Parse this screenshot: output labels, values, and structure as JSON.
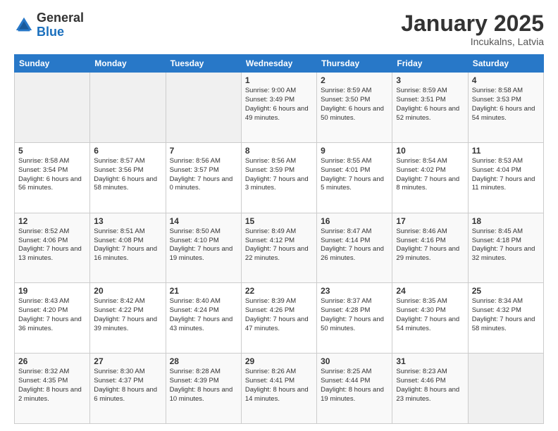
{
  "header": {
    "logo_general": "General",
    "logo_blue": "Blue",
    "title": "January 2025",
    "subtitle": "Incukalns, Latvia"
  },
  "weekdays": [
    "Sunday",
    "Monday",
    "Tuesday",
    "Wednesday",
    "Thursday",
    "Friday",
    "Saturday"
  ],
  "weeks": [
    [
      {
        "day": "",
        "sunrise": "",
        "sunset": "",
        "daylight": "",
        "empty": true
      },
      {
        "day": "",
        "sunrise": "",
        "sunset": "",
        "daylight": "",
        "empty": true
      },
      {
        "day": "",
        "sunrise": "",
        "sunset": "",
        "daylight": "",
        "empty": true
      },
      {
        "day": "1",
        "sunrise": "Sunrise: 9:00 AM",
        "sunset": "Sunset: 3:49 PM",
        "daylight": "Daylight: 6 hours and 49 minutes."
      },
      {
        "day": "2",
        "sunrise": "Sunrise: 8:59 AM",
        "sunset": "Sunset: 3:50 PM",
        "daylight": "Daylight: 6 hours and 50 minutes."
      },
      {
        "day": "3",
        "sunrise": "Sunrise: 8:59 AM",
        "sunset": "Sunset: 3:51 PM",
        "daylight": "Daylight: 6 hours and 52 minutes."
      },
      {
        "day": "4",
        "sunrise": "Sunrise: 8:58 AM",
        "sunset": "Sunset: 3:53 PM",
        "daylight": "Daylight: 6 hours and 54 minutes."
      }
    ],
    [
      {
        "day": "5",
        "sunrise": "Sunrise: 8:58 AM",
        "sunset": "Sunset: 3:54 PM",
        "daylight": "Daylight: 6 hours and 56 minutes."
      },
      {
        "day": "6",
        "sunrise": "Sunrise: 8:57 AM",
        "sunset": "Sunset: 3:56 PM",
        "daylight": "Daylight: 6 hours and 58 minutes."
      },
      {
        "day": "7",
        "sunrise": "Sunrise: 8:56 AM",
        "sunset": "Sunset: 3:57 PM",
        "daylight": "Daylight: 7 hours and 0 minutes."
      },
      {
        "day": "8",
        "sunrise": "Sunrise: 8:56 AM",
        "sunset": "Sunset: 3:59 PM",
        "daylight": "Daylight: 7 hours and 3 minutes."
      },
      {
        "day": "9",
        "sunrise": "Sunrise: 8:55 AM",
        "sunset": "Sunset: 4:01 PM",
        "daylight": "Daylight: 7 hours and 5 minutes."
      },
      {
        "day": "10",
        "sunrise": "Sunrise: 8:54 AM",
        "sunset": "Sunset: 4:02 PM",
        "daylight": "Daylight: 7 hours and 8 minutes."
      },
      {
        "day": "11",
        "sunrise": "Sunrise: 8:53 AM",
        "sunset": "Sunset: 4:04 PM",
        "daylight": "Daylight: 7 hours and 11 minutes."
      }
    ],
    [
      {
        "day": "12",
        "sunrise": "Sunrise: 8:52 AM",
        "sunset": "Sunset: 4:06 PM",
        "daylight": "Daylight: 7 hours and 13 minutes."
      },
      {
        "day": "13",
        "sunrise": "Sunrise: 8:51 AM",
        "sunset": "Sunset: 4:08 PM",
        "daylight": "Daylight: 7 hours and 16 minutes."
      },
      {
        "day": "14",
        "sunrise": "Sunrise: 8:50 AM",
        "sunset": "Sunset: 4:10 PM",
        "daylight": "Daylight: 7 hours and 19 minutes."
      },
      {
        "day": "15",
        "sunrise": "Sunrise: 8:49 AM",
        "sunset": "Sunset: 4:12 PM",
        "daylight": "Daylight: 7 hours and 22 minutes."
      },
      {
        "day": "16",
        "sunrise": "Sunrise: 8:47 AM",
        "sunset": "Sunset: 4:14 PM",
        "daylight": "Daylight: 7 hours and 26 minutes."
      },
      {
        "day": "17",
        "sunrise": "Sunrise: 8:46 AM",
        "sunset": "Sunset: 4:16 PM",
        "daylight": "Daylight: 7 hours and 29 minutes."
      },
      {
        "day": "18",
        "sunrise": "Sunrise: 8:45 AM",
        "sunset": "Sunset: 4:18 PM",
        "daylight": "Daylight: 7 hours and 32 minutes."
      }
    ],
    [
      {
        "day": "19",
        "sunrise": "Sunrise: 8:43 AM",
        "sunset": "Sunset: 4:20 PM",
        "daylight": "Daylight: 7 hours and 36 minutes."
      },
      {
        "day": "20",
        "sunrise": "Sunrise: 8:42 AM",
        "sunset": "Sunset: 4:22 PM",
        "daylight": "Daylight: 7 hours and 39 minutes."
      },
      {
        "day": "21",
        "sunrise": "Sunrise: 8:40 AM",
        "sunset": "Sunset: 4:24 PM",
        "daylight": "Daylight: 7 hours and 43 minutes."
      },
      {
        "day": "22",
        "sunrise": "Sunrise: 8:39 AM",
        "sunset": "Sunset: 4:26 PM",
        "daylight": "Daylight: 7 hours and 47 minutes."
      },
      {
        "day": "23",
        "sunrise": "Sunrise: 8:37 AM",
        "sunset": "Sunset: 4:28 PM",
        "daylight": "Daylight: 7 hours and 50 minutes."
      },
      {
        "day": "24",
        "sunrise": "Sunrise: 8:35 AM",
        "sunset": "Sunset: 4:30 PM",
        "daylight": "Daylight: 7 hours and 54 minutes."
      },
      {
        "day": "25",
        "sunrise": "Sunrise: 8:34 AM",
        "sunset": "Sunset: 4:32 PM",
        "daylight": "Daylight: 7 hours and 58 minutes."
      }
    ],
    [
      {
        "day": "26",
        "sunrise": "Sunrise: 8:32 AM",
        "sunset": "Sunset: 4:35 PM",
        "daylight": "Daylight: 8 hours and 2 minutes."
      },
      {
        "day": "27",
        "sunrise": "Sunrise: 8:30 AM",
        "sunset": "Sunset: 4:37 PM",
        "daylight": "Daylight: 8 hours and 6 minutes."
      },
      {
        "day": "28",
        "sunrise": "Sunrise: 8:28 AM",
        "sunset": "Sunset: 4:39 PM",
        "daylight": "Daylight: 8 hours and 10 minutes."
      },
      {
        "day": "29",
        "sunrise": "Sunrise: 8:26 AM",
        "sunset": "Sunset: 4:41 PM",
        "daylight": "Daylight: 8 hours and 14 minutes."
      },
      {
        "day": "30",
        "sunrise": "Sunrise: 8:25 AM",
        "sunset": "Sunset: 4:44 PM",
        "daylight": "Daylight: 8 hours and 19 minutes."
      },
      {
        "day": "31",
        "sunrise": "Sunrise: 8:23 AM",
        "sunset": "Sunset: 4:46 PM",
        "daylight": "Daylight: 8 hours and 23 minutes."
      },
      {
        "day": "",
        "sunrise": "",
        "sunset": "",
        "daylight": "",
        "empty": true
      }
    ]
  ]
}
